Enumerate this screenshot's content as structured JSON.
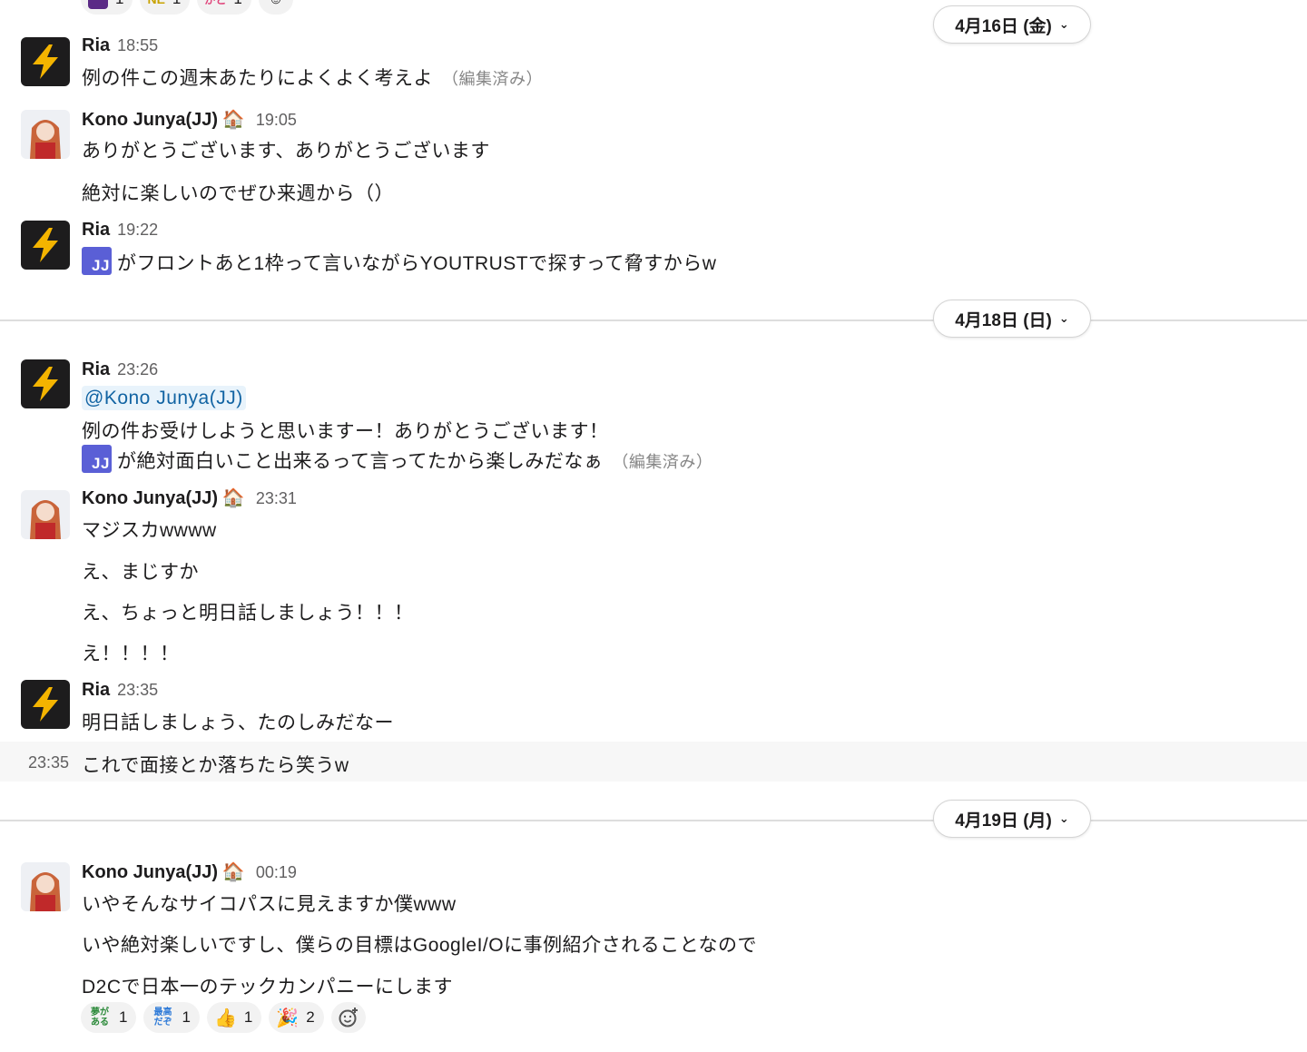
{
  "top_reactions": [
    {
      "emoji_name": "custom-emoji-purple",
      "count": "1"
    },
    {
      "emoji_name": "custom-emoji-ne",
      "label": "NE",
      "count": "1"
    },
    {
      "emoji_name": "custom-emoji-arigato",
      "label": "がと",
      "count": "1"
    }
  ],
  "date_dividers": [
    {
      "label": "4月16日 (金)"
    },
    {
      "label": "4月18日 (日)"
    },
    {
      "label": "4月19日 (月)"
    }
  ],
  "messages": [
    {
      "author": "Ria",
      "time": "18:55",
      "avatar_icon": "lightning-bolt-icon",
      "lines": [
        "例の件この週末あたりによくよく考えよ"
      ],
      "edited": "（編集済み）"
    },
    {
      "author": "Kono Junya(JJ)",
      "status_icon": "house-icon",
      "time": "19:05",
      "lines": [
        "ありがとうございます、ありがとうございます",
        "絶対に楽しいのでぜひ来週から（）"
      ]
    },
    {
      "author": "Ria",
      "time": "19:22",
      "avatar_icon": "lightning-bolt-icon",
      "chip": "JJ",
      "lines": [
        "がフロントあと1枠って言いながらYOUTRUSTで探すって脅すからw"
      ]
    },
    {
      "author": "Ria",
      "time": "23:26",
      "avatar_icon": "lightning-bolt-icon",
      "mention": "@Kono Junya(JJ)",
      "chip": "JJ",
      "lines": [
        "例の件お受けしようと思いますー！ありがとうございます！",
        "が絶対面白いこと出来るって言ってたから楽しみだなぁ"
      ],
      "edited": "（編集済み）"
    },
    {
      "author": "Kono Junya(JJ)",
      "status_icon": "house-icon",
      "time": "23:31",
      "lines": [
        "マジスカwwww",
        "え、まじすか",
        "え、ちょっと明日話しましょう！！！",
        "え！！！！"
      ]
    },
    {
      "author": "Ria",
      "time": "23:35",
      "avatar_icon": "lightning-bolt-icon",
      "lines": [
        "明日話しましょう、たのしみだなー"
      ],
      "continuation": {
        "time": "23:35",
        "text": "これで面接とか落ちたら笑うw"
      }
    },
    {
      "author": "Kono Junya(JJ)",
      "status_icon": "house-icon",
      "time": "00:19",
      "lines": [
        "いやそんなサイコパスに見えますか僕www",
        "いや絶対楽しいですし、僕らの目標はGoogleI/Oに事例紹介されることなので",
        "D2Cで日本一のテックカンパニーにします"
      ]
    }
  ],
  "bottom_reactions": [
    {
      "emoji_name": "yume-ga-aru-emoji",
      "label": "夢が ある",
      "count": "1",
      "color": "#2e8b3c"
    },
    {
      "emoji_name": "saikou-dazo-emoji",
      "label": "最高 だぞ",
      "count": "1",
      "color": "#2f7bd8"
    },
    {
      "emoji_name": "thumbs-up-icon",
      "count": "1"
    },
    {
      "emoji_name": "party-popper-icon",
      "count": "2"
    }
  ],
  "colors": {
    "accent_mention_bg": "#e8f3fb",
    "mention_text": "#1264a3",
    "jj_chip": "#5a5fd6",
    "bolt": "#f4b400"
  }
}
